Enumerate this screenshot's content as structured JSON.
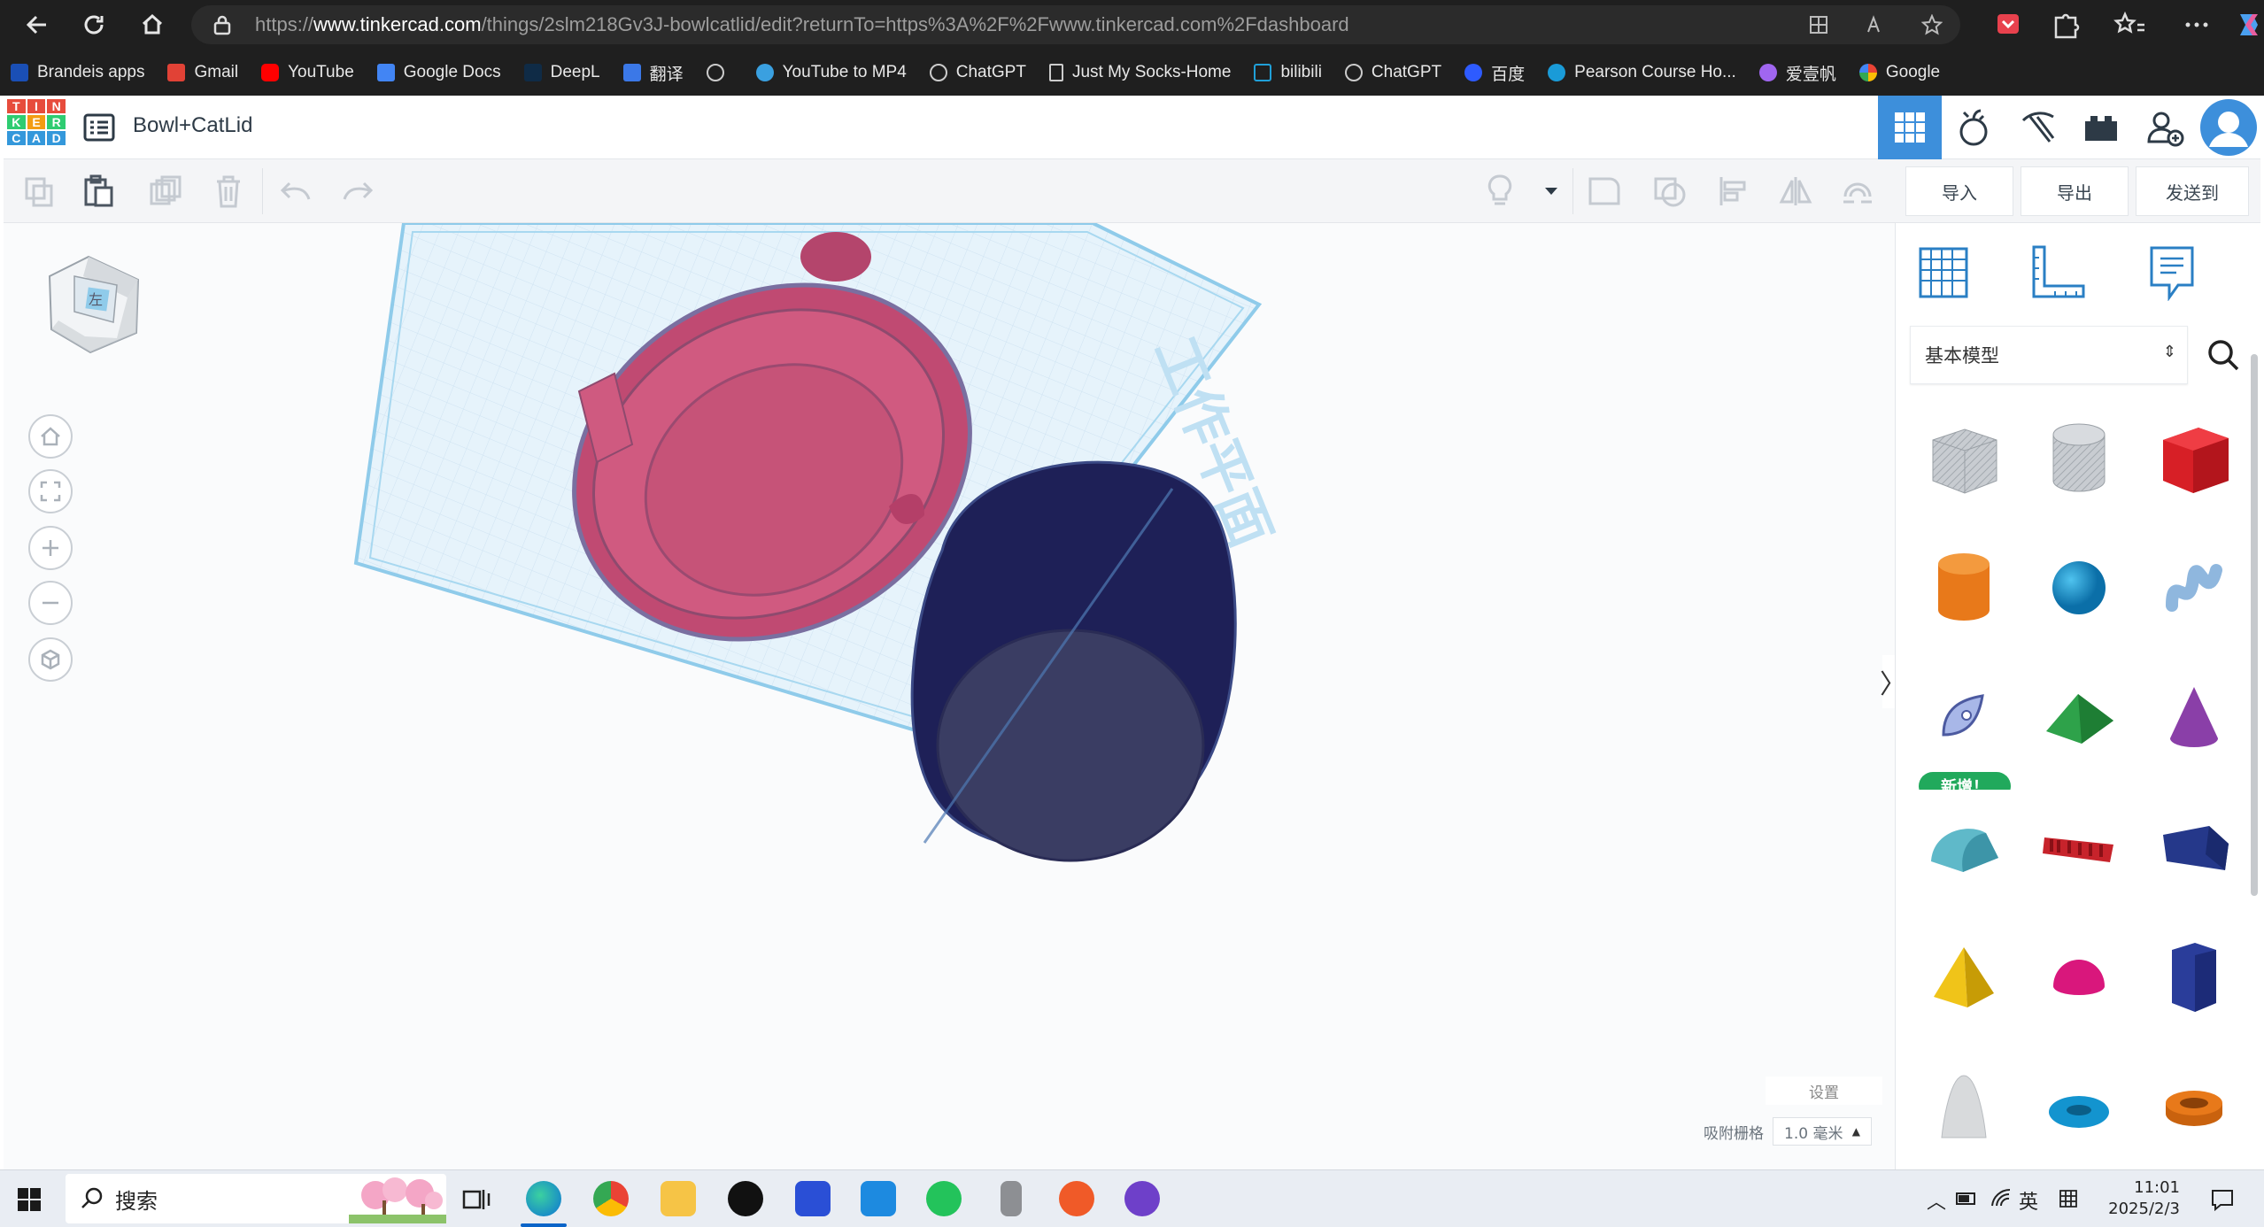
{
  "browser": {
    "url_prefix": "https://",
    "url_host": "www.tinkercad.com",
    "url_path": "/things/2slm218Gv3J-bowlcatlid/edit?returnTo=https%3A%2F%2Fwww.tinkercad.com%2Fdashboard",
    "bookmarks": [
      {
        "label": "Brandeis apps",
        "color": "#1a4fb5"
      },
      {
        "label": "Gmail",
        "color": "#e14236"
      },
      {
        "label": "YouTube",
        "color": "#ff0000"
      },
      {
        "label": "Google Docs",
        "color": "#4285f4"
      },
      {
        "label": "DeepL",
        "color": "#0f2b46"
      },
      {
        "label": "翻译",
        "color": "#3b78e7"
      },
      {
        "label": "",
        "color": "#bbbbbb"
      },
      {
        "label": "YouTube to MP4",
        "color": "#3aa0e0"
      },
      {
        "label": "ChatGPT",
        "color": "#cccccc"
      },
      {
        "label": "Just My Socks-Home",
        "color": "#dddddd"
      },
      {
        "label": "bilibili",
        "color": "#20a0d8"
      },
      {
        "label": "ChatGPT",
        "color": "#cccccc"
      },
      {
        "label": "百度",
        "color": "#2e5bff"
      },
      {
        "label": "Pearson Course Ho...",
        "color": "#1a9bd8"
      },
      {
        "label": "爱壹帆",
        "color": "#a066f0"
      },
      {
        "label": "Google",
        "color": "#4285f4"
      }
    ]
  },
  "app": {
    "logo_letters": [
      "T",
      "I",
      "N",
      "K",
      "E",
      "R",
      "C",
      "A",
      "D"
    ],
    "logo_colors": [
      "#e74c3c",
      "#e74c3c",
      "#e74c3c",
      "#2ecc71",
      "#f39c12",
      "#2ecc71",
      "#3498db",
      "#3498db",
      "#3498db"
    ],
    "design_title": "Bowl+CatLid",
    "toolbar": {
      "import_label": "导入",
      "export_label": "导出",
      "send_label": "发送到"
    },
    "workplane": {
      "viewcube_label": "左",
      "watermark": "工作平面",
      "settings_label": "设置",
      "snap_label": "吸附栅格",
      "snap_value": "1.0 毫米"
    },
    "panel": {
      "category": "基本模型",
      "new_badge": "新增！",
      "shapes": [
        "box-hole-shape",
        "cylinder-hole-shape",
        "box-shape",
        "cylinder-shape",
        "sphere-shape",
        "scribble-shape",
        "sketch-shape",
        "roof-shape",
        "cone-shape",
        "round-roof-shape",
        "text-shape",
        "wedge-shape",
        "pyramid-shape",
        "half-sphere-shape",
        "polygon-shape",
        "paraboloid-shape",
        "torus-shape",
        "tube-shape"
      ]
    },
    "accent_color": "#3d8fdb"
  },
  "taskbar": {
    "search_label": "搜索",
    "time": "11:01",
    "date": "2025/2/3",
    "ime": "英"
  }
}
